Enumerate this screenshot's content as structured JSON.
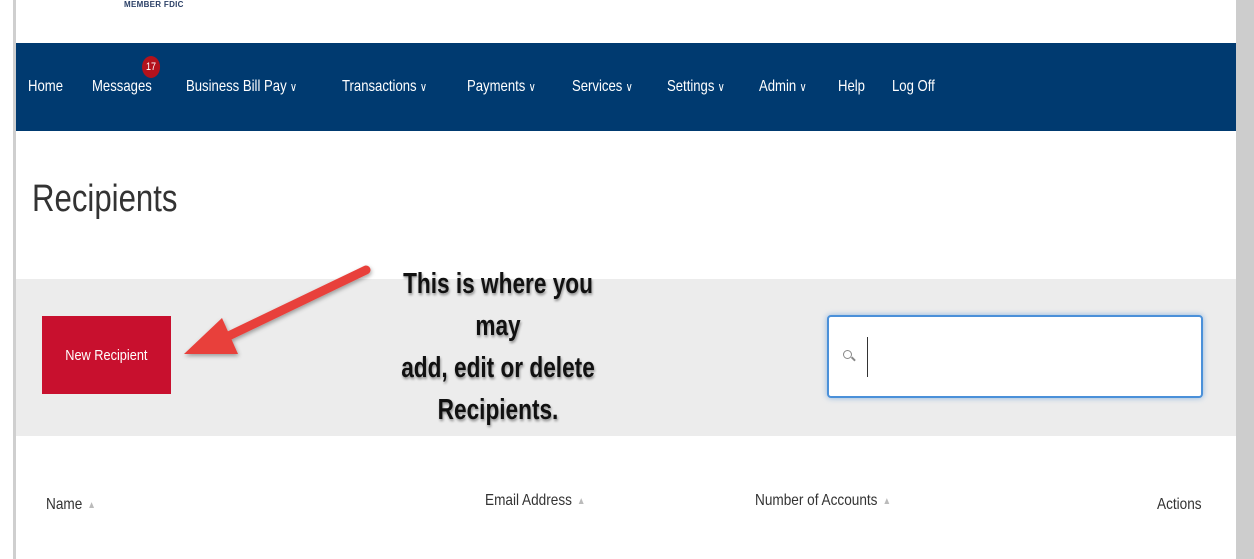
{
  "header": {
    "logo_text": "MEMBER FDIC"
  },
  "nav": {
    "items": [
      {
        "label": "Home",
        "chevron": ""
      },
      {
        "label": "Messages",
        "chevron": "",
        "badge": "17"
      },
      {
        "label": "Business Bill Pay",
        "chevron": "∨"
      },
      {
        "label": "Transactions",
        "chevron": "∨"
      },
      {
        "label": "Payments",
        "chevron": "∨"
      },
      {
        "label": "Services",
        "chevron": "∨"
      },
      {
        "label": "Settings",
        "chevron": "∨"
      },
      {
        "label": "Admin",
        "chevron": "∨"
      },
      {
        "label": "Help",
        "chevron": ""
      },
      {
        "label": "Log Off",
        "chevron": ""
      }
    ]
  },
  "page": {
    "title": "Recipients"
  },
  "toolbar": {
    "new_button_label": "New Recipient",
    "search_value": "",
    "search_icon": "search-icon"
  },
  "annotation": {
    "lines": [
      "This is where you may",
      "add, edit or delete",
      "Recipients."
    ],
    "color": "#e8403a"
  },
  "table": {
    "columns": [
      {
        "label": "Name",
        "sortable": true
      },
      {
        "label": "Email Address",
        "sortable": true
      },
      {
        "label": "Number of Accounts",
        "sortable": true
      },
      {
        "label": "Actions",
        "sortable": false
      }
    ]
  },
  "colors": {
    "nav_bg": "#003a70",
    "button_bg": "#c8102e",
    "badge_bg": "#b3121c",
    "focus": "#4a90d9"
  }
}
